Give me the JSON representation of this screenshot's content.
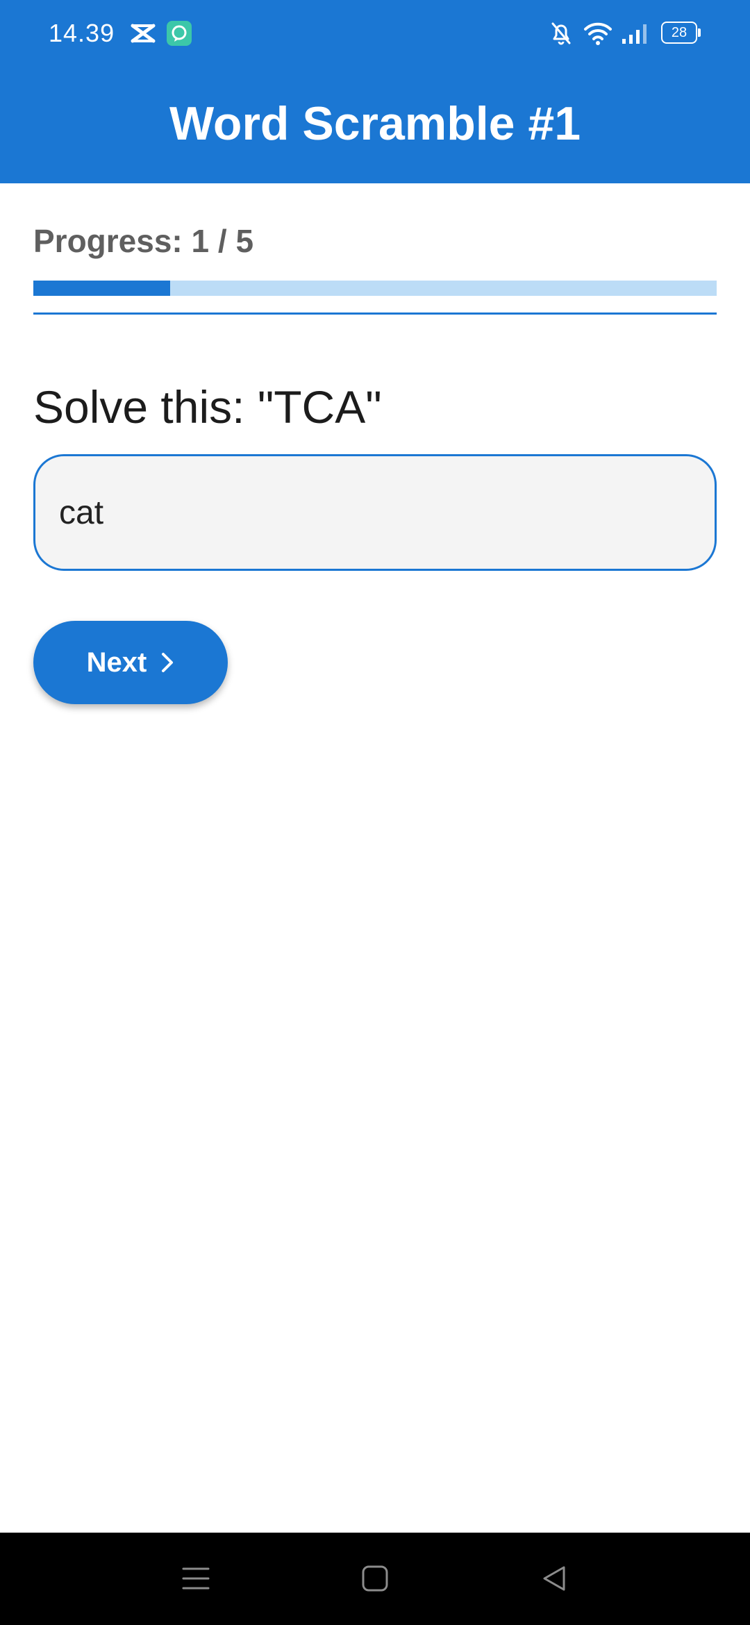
{
  "status_bar": {
    "time": "14.39",
    "battery_level": "28",
    "icons": [
      "capcut-icon",
      "chat-app-icon",
      "bell-muted-icon",
      "wifi-icon",
      "signal-icon",
      "battery-icon"
    ]
  },
  "app_bar": {
    "title": "Word Scramble #1",
    "color": "#1b77d3"
  },
  "progress": {
    "label": "Progress: 1 / 5",
    "current": 1,
    "total": 5,
    "fraction": 0.2
  },
  "question": {
    "prompt": "Solve this: \"TCA\""
  },
  "answer": {
    "value": "cat",
    "placeholder": ""
  },
  "actions": {
    "next_label": "Next",
    "next_icon": "chevron-right-icon"
  },
  "navigation_bar": {
    "icons": [
      "menu-icon",
      "home-icon",
      "back-icon"
    ]
  }
}
